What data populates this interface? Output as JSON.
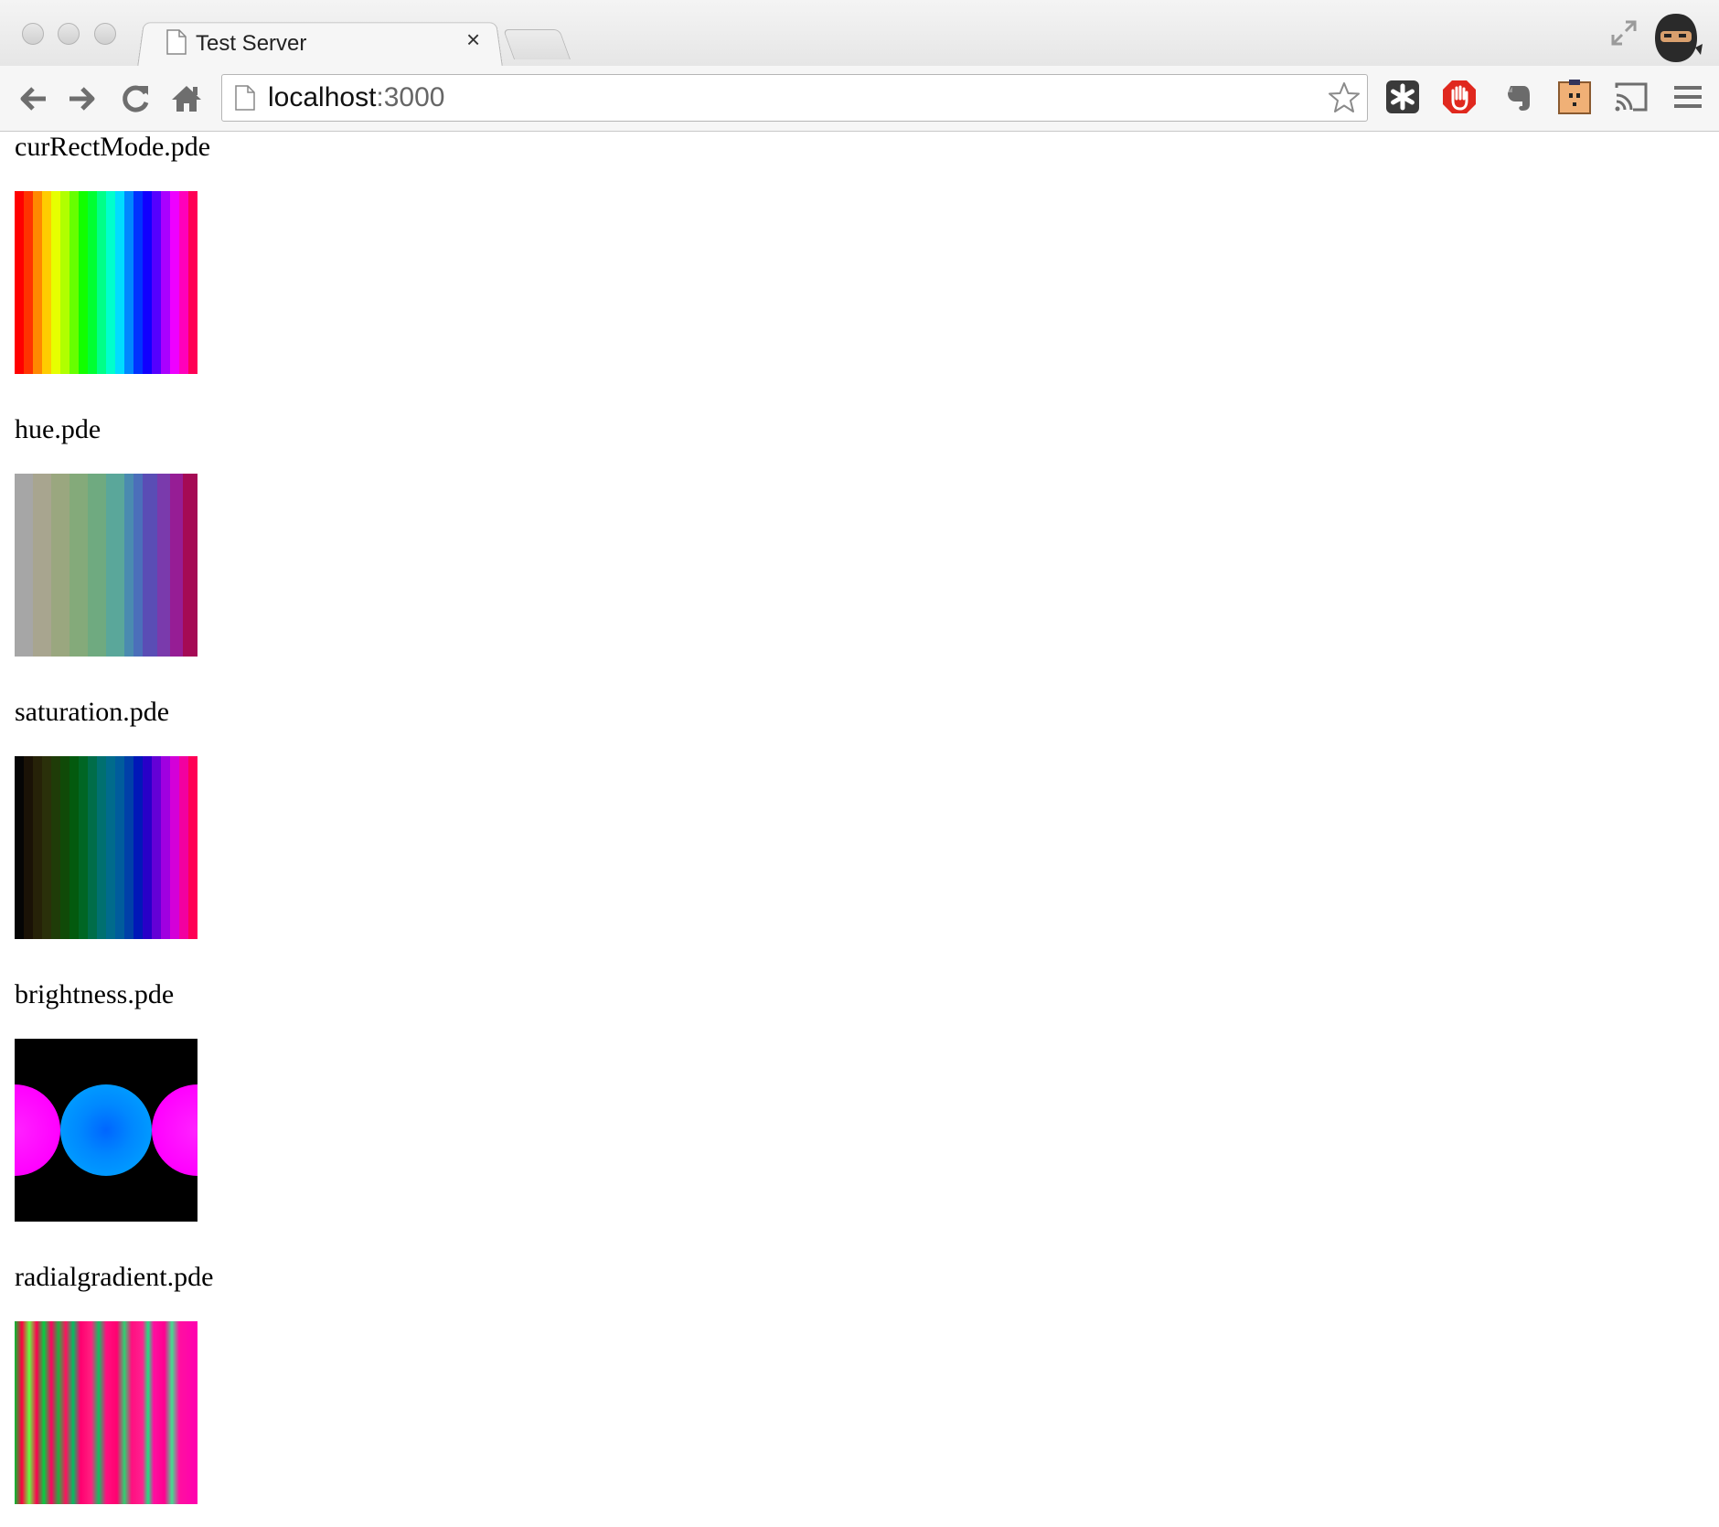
{
  "browser": {
    "tab_title": "Test Server",
    "tab_close": "×",
    "url_host": "localhost",
    "url_port": ":3000"
  },
  "sketches": [
    {
      "label": "curRectMode.pde"
    },
    {
      "label": "hue.pde"
    },
    {
      "label": "saturation.pde"
    },
    {
      "label": "brightness.pde"
    },
    {
      "label": "radialgradient.pde"
    }
  ],
  "icons": {
    "back": "back-arrow-icon",
    "forward": "forward-arrow-icon",
    "reload": "reload-icon",
    "home": "home-icon",
    "bookmark": "star-icon",
    "menu": "hamburger-menu-icon"
  }
}
